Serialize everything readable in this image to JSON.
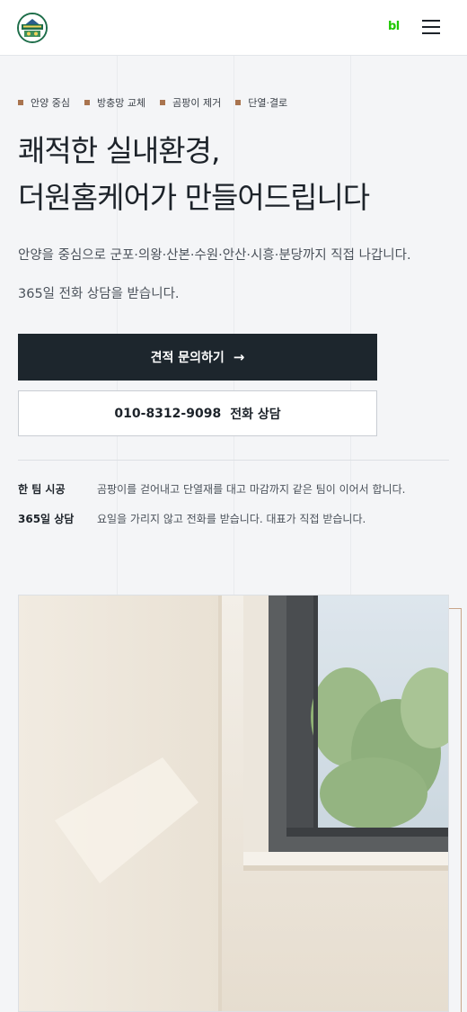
{
  "header": {
    "blog_label": "bl",
    "logo_icon": "company-logo-emblem",
    "menu_icon": "hamburger-menu-icon"
  },
  "hero": {
    "tags": [
      "안양 중심",
      "방충망 교체",
      "곰팡이 제거",
      "단열·결로"
    ],
    "headline_line1": "쾌적한 실내환경,",
    "headline_line2": "더원홈케어가 만들어드립니다",
    "intro_line1": "안양을 중심으로 군포·의왕·산본·수원·안산·시흥·분당까지 직접 나갑니다.",
    "intro_line2": "365일 전화 상담을 받습니다.",
    "cta_primary": "견적 문의하기",
    "cta_arrow": "→",
    "cta_phone": "010-8312-9098",
    "cta_phone_suffix": "전화 상담",
    "info": [
      {
        "label": "한 팀 시공",
        "text": "곰팡이를 걷어내고 단열재를 대고 마감까지 같은 팀이 이어서 합니다."
      },
      {
        "label": "365일 상담",
        "text": "요일을 가리지 않고 전화를 받습니다. 대표가 직접 받습니다."
      }
    ]
  },
  "colors": {
    "accent": "#a9744f",
    "dark_button": "#1d262d",
    "blog_green": "#1ec800"
  }
}
